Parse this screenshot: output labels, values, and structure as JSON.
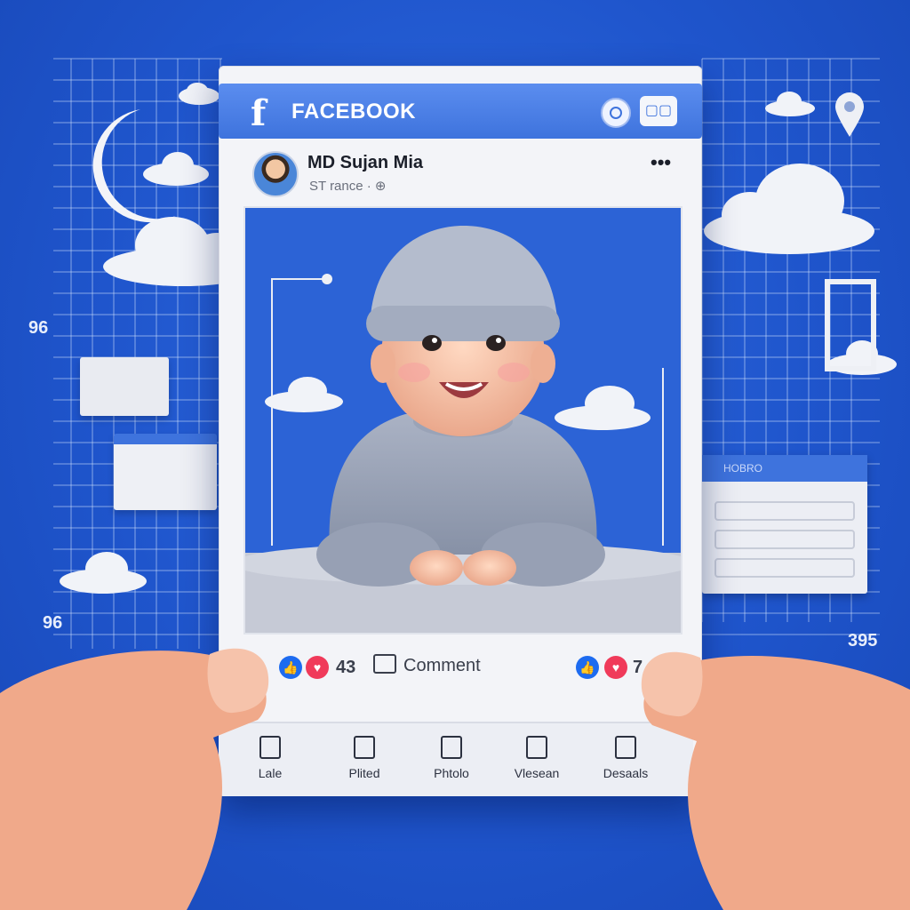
{
  "post": {
    "brand": "FACEBOOK",
    "logo_glyph": "f",
    "message_icon": "messenger-icon",
    "author": "MD Sujan Mia",
    "subline": "ST rance ·",
    "more": "•••",
    "reaction_count": "43",
    "comment_label": "Comment",
    "right_count": "7",
    "actions": [
      {
        "label": "Lale",
        "icon": "like-icon"
      },
      {
        "label": "Plited",
        "icon": "pin-icon"
      },
      {
        "label": "Phtolo",
        "icon": "photo-icon"
      },
      {
        "label": "Vlesean",
        "icon": "send-icon"
      },
      {
        "label": "Desaals",
        "icon": "share-icon"
      }
    ]
  },
  "side_labels": {
    "left_top": "96",
    "left_bottom": "96",
    "right_bottom": "395"
  },
  "panel_label": "HOBRO",
  "colors": {
    "background": "#1f55cc",
    "topbar": "#3e73dd",
    "card": "#f3f4f8",
    "like": "#1d6bf0",
    "heart": "#f03a5a"
  }
}
